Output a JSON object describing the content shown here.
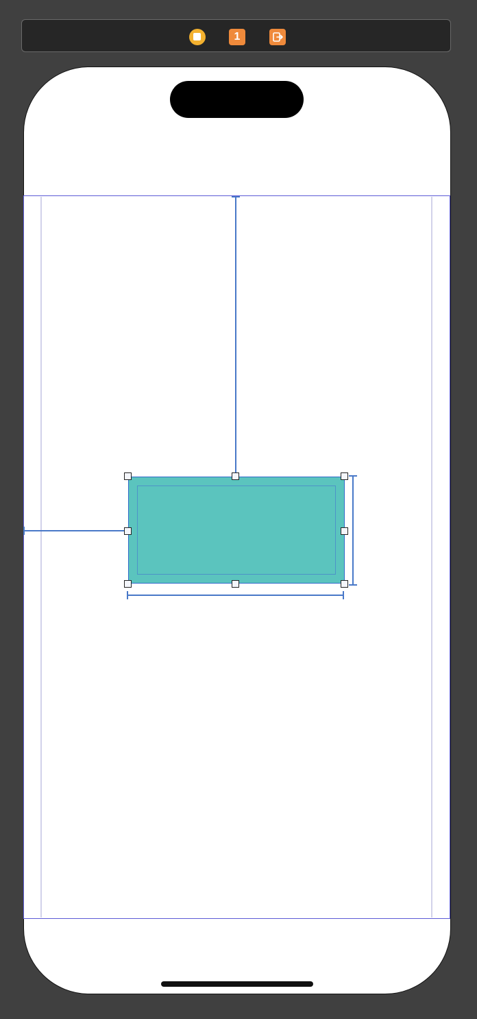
{
  "scene_dock": {
    "view_controller_icon": "view-controller-icon",
    "first_responder_icon": "first-responder-icon",
    "first_responder_label": "1",
    "exit_icon": "exit-icon"
  },
  "canvas": {
    "device": "iphone-with-dynamic-island",
    "selected_view": {
      "fill_color": "#5bc4be",
      "selection_color": "#2f69c9"
    },
    "constraints": [
      "top-to-safe-area",
      "leading-to-safe-area",
      "width",
      "height"
    ]
  },
  "colors": {
    "background": "#404040",
    "dock": "#262626",
    "vc_icon": "#f3b12f",
    "first_responder": "#ef8a3b",
    "exit": "#ef8a3b",
    "safe_area": "#5c5ad6",
    "constraint": "#4878c8"
  }
}
